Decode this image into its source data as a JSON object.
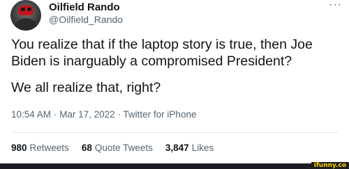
{
  "author": {
    "display_name": "Oilfield Rando",
    "handle": "@Oilfield_Rando"
  },
  "more_icon": "more-horizontal-icon",
  "tweet": {
    "paragraphs": [
      "You realize that if the laptop story is true, then Joe Biden is inarguably a compromised President?",
      "We all realize that, right?"
    ]
  },
  "meta": {
    "time": "10:54 AM",
    "separator": "·",
    "date": "Mar 17, 2022",
    "source": "Twitter for iPhone"
  },
  "stats": {
    "retweets": {
      "count": "980",
      "label": "Retweets"
    },
    "quotes": {
      "count": "68",
      "label": "Quote Tweets"
    },
    "likes": {
      "count": "3,847",
      "label": "Likes"
    }
  },
  "watermark": "ifunny.co",
  "colors": {
    "text": "#0f1419",
    "secondary": "#536471",
    "watermark": "#ffd600"
  }
}
